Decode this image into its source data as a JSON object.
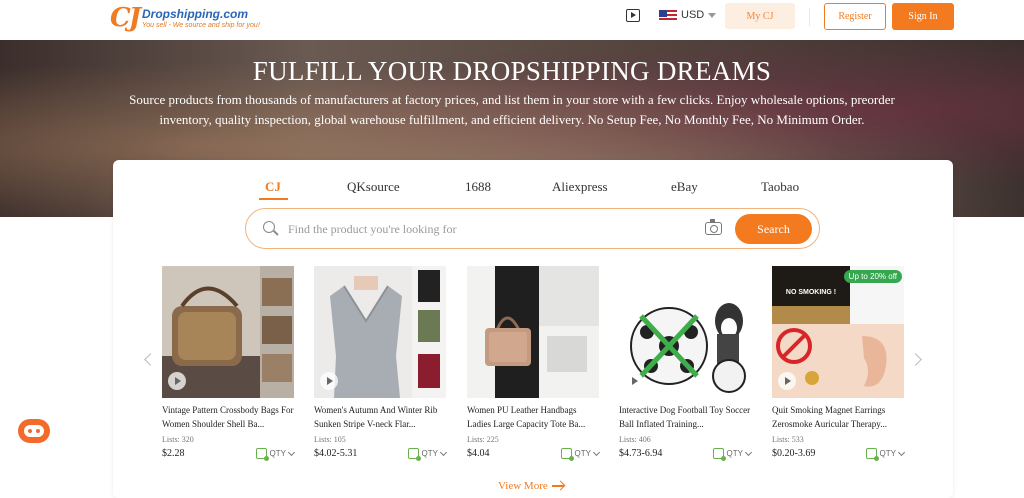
{
  "header": {
    "logo_mark": "CJ",
    "logo_name": "Dropshipping.com",
    "logo_tagline": "You sell - We source and ship for you!",
    "currency": "USD",
    "my_cj": "My CJ",
    "register": "Register",
    "sign_in": "Sign In"
  },
  "hero": {
    "title": "FULFILL YOUR DROPSHIPPING DREAMS",
    "subtitle": "Source products from thousands of manufacturers at factory prices, and list them in your store with a few clicks. Enjoy wholesale options, preorder inventory, quality inspection, global warehouse fulfillment, and efficient delivery. No Setup Fee, No Monthly Fee, No Minimum Order."
  },
  "tabs": [
    "CJ",
    "QKsource",
    "1688",
    "Aliexpress",
    "eBay",
    "Taobao"
  ],
  "search": {
    "placeholder": "Find the product you're looking for",
    "button": "Search"
  },
  "products": [
    {
      "title": "Vintage Pattern Crossbody Bags For Women Shoulder Shell Ba...",
      "lists": "Lists: 320",
      "price": "$2.28",
      "qty": "QTY"
    },
    {
      "title": "Women's Autumn And Winter Rib Sunken Stripe V-neck Flar...",
      "lists": "Lists: 105",
      "price": "$4.02-5.31",
      "qty": "QTY"
    },
    {
      "title": "Women PU Leather Handbags Ladies Large Capacity Tote Ba...",
      "lists": "Lists: 225",
      "price": "$4.04",
      "qty": "QTY"
    },
    {
      "title": "Interactive Dog Football Toy Soccer Ball Inflated Training...",
      "lists": "Lists: 406",
      "price": "$4.73-6.94",
      "qty": "QTY"
    },
    {
      "title": "Quit Smoking Magnet Earrings Zerosmoke Auricular Therapy...",
      "lists": "Lists: 533",
      "price": "$0.20-3.69",
      "qty": "QTY",
      "badge": "Up to 20% off",
      "image_text": "NO SMOKING !"
    }
  ],
  "view_more": "View More"
}
